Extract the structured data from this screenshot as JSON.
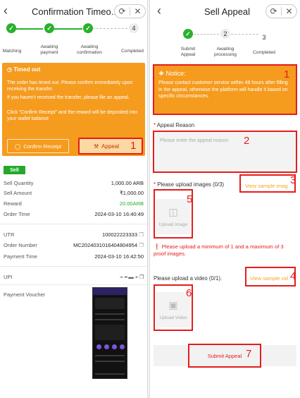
{
  "left": {
    "title": "Confirmation Timeo...",
    "steps": [
      {
        "label": "Matching",
        "state": "done"
      },
      {
        "label": "Awaiting payment",
        "state": "done"
      },
      {
        "label": "Awaiting confirmation",
        "state": "done"
      },
      {
        "label": "Completed",
        "state": "todo",
        "num": "4"
      }
    ],
    "timeout_title": "Timed out",
    "timeout_text1": "The order has timed out. Please confirm immediately upon receiving the transfer.",
    "timeout_text2": "If you haven't received the transfer, please file an appeal.",
    "timeout_text3": "Click \"Confirm Receipt\" and the reward will be deposited into your wallet balance",
    "confirm_label": "Confirm Receipt",
    "appeal_label": "Appeal",
    "sell_badge": "Sell",
    "rows": [
      {
        "k": "Sell Quantity",
        "v": "1,000.00 ARB"
      },
      {
        "k": "Sell Amount",
        "v": "₹1,000.00"
      },
      {
        "k": "Reward",
        "v": "20.00ARB"
      },
      {
        "k": "Order Time",
        "v": "2024-03-10 16:40:49"
      },
      {
        "k": "UTR",
        "v": "100022223333"
      },
      {
        "k": "Order Number",
        "v": "MC2024031016404804954"
      },
      {
        "k": "Payment Time",
        "v": "2024-03-10 16:42:50"
      },
      {
        "k": "UPI",
        "v": ""
      },
      {
        "k": "Payment Voucher",
        "v": ""
      }
    ],
    "reward_color": "#24a82b"
  },
  "right": {
    "title": "Sell Appeal",
    "steps": [
      {
        "label": "Submit Appeal",
        "state": "done"
      },
      {
        "label": "Awaiting processing",
        "state": "todo",
        "num": "2"
      },
      {
        "label": "Completed",
        "state": "todo",
        "num": "3"
      }
    ],
    "notice_title": "Notice:",
    "notice_text": "Please contact customer service within 48 hours after filling in the appeal, otherwise the platform will handle it based on specific circumstances.",
    "reason_label": "Appeal Reason",
    "reason_placeholder": "Please enter the appeal reason",
    "images_label": "Please upload images (0/3)",
    "view_sample_images": "View sample imag",
    "upload_image": "Upload Image",
    "images_warning": "Please upload a minimum of 1 and a maximum of 3 proof images.",
    "video_label": "Please upload a video (0/1).",
    "view_sample_video": "View sample vid",
    "upload_video": "Upload Video",
    "submit_label": "Submit Appeal"
  },
  "markers": [
    "1",
    "1",
    "2",
    "3",
    "4",
    "5",
    "6",
    "7"
  ],
  "colors": {
    "accent": "#f59b1e",
    "success": "#29b12c",
    "highlight": "#e51c1c",
    "link": "#f5a623"
  }
}
